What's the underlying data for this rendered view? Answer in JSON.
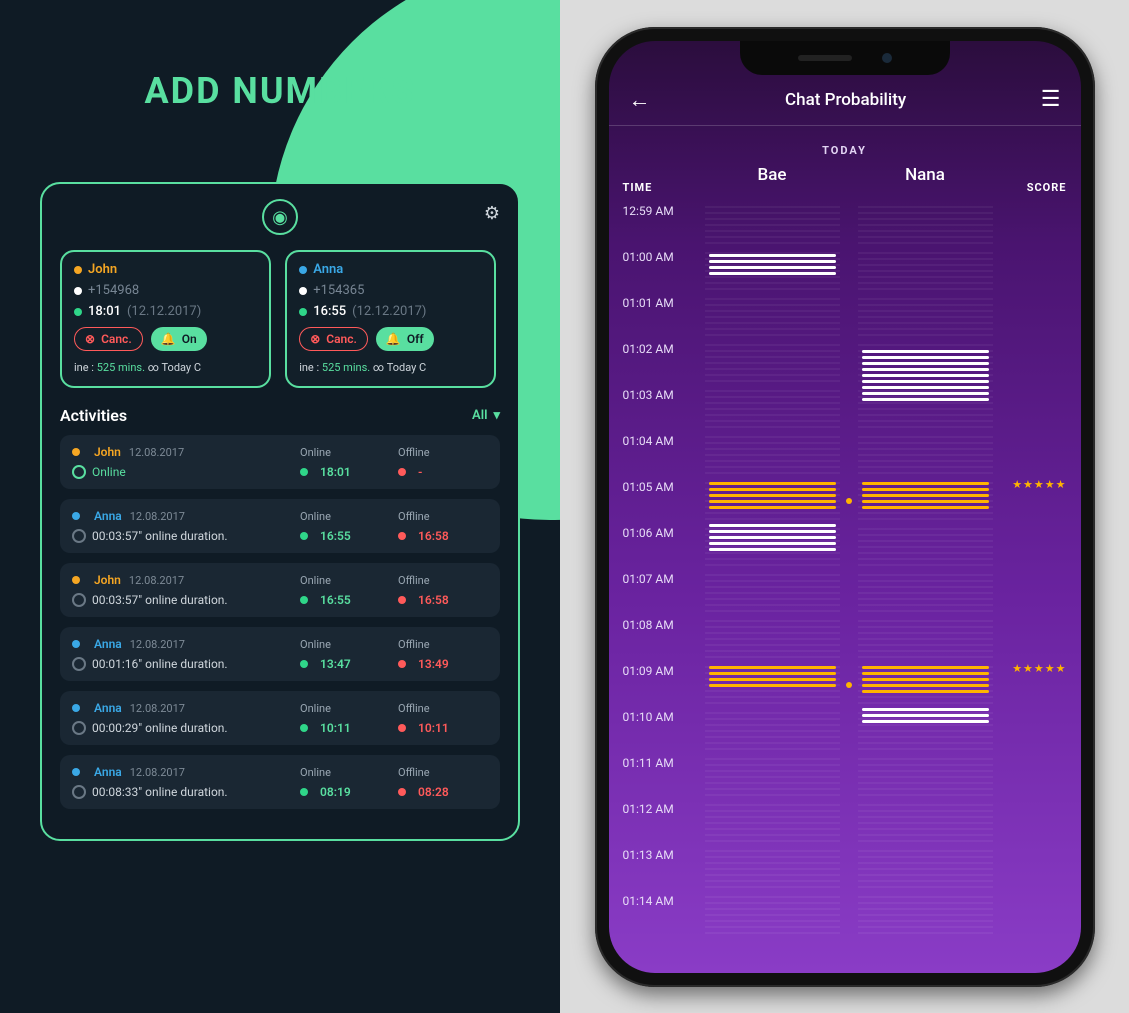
{
  "left": {
    "title": "ADD NUMBERS",
    "contacts": [
      {
        "name": "John",
        "nameClass": "name-orange",
        "dotClass": "dot-orange",
        "phone": "+154968",
        "time": "18:01",
        "date": "(12.12.2017)",
        "toggle": "On",
        "cancel": "Canc.",
        "ticker_prefix": "ine :",
        "ticker_mins": "525 mins.",
        "ticker_tail": "∞  Today  C"
      },
      {
        "name": "Anna",
        "nameClass": "name-blue",
        "dotClass": "dot-blue",
        "phone": "+154365",
        "time": "16:55",
        "date": "(12.12.2017)",
        "toggle": "Off",
        "cancel": "Canc.",
        "ticker_prefix": "ine :",
        "ticker_mins": "525 mins.",
        "ticker_tail": "∞  Today  C"
      }
    ],
    "activities_title": "Activities",
    "filter": "All",
    "headers": {
      "online": "Online",
      "offline": "Offline"
    },
    "activities": [
      {
        "name": "John",
        "nameClass": "name-orange",
        "dotClass": "dot-orange",
        "date": "12.08.2017",
        "status": "Online",
        "statusIcon": "green",
        "online": "18:01",
        "offline": "-"
      },
      {
        "name": "Anna",
        "nameClass": "name-blue",
        "dotClass": "dot-blue",
        "date": "12.08.2017",
        "status": "00:03:57\" online duration.",
        "statusIcon": "grey",
        "online": "16:55",
        "offline": "16:58"
      },
      {
        "name": "John",
        "nameClass": "name-orange",
        "dotClass": "dot-orange",
        "date": "12.08.2017",
        "status": "00:03:57\" online duration.",
        "statusIcon": "grey",
        "online": "16:55",
        "offline": "16:58"
      },
      {
        "name": "Anna",
        "nameClass": "name-blue",
        "dotClass": "dot-blue",
        "date": "12.08.2017",
        "status": "00:01:16\" online duration.",
        "statusIcon": "grey",
        "online": "13:47",
        "offline": "13:49"
      },
      {
        "name": "Anna",
        "nameClass": "name-blue",
        "dotClass": "dot-blue",
        "date": "12.08.2017",
        "status": "00:00:29\" online duration.",
        "statusIcon": "grey",
        "online": "10:11",
        "offline": "10:11"
      },
      {
        "name": "Anna",
        "nameClass": "name-blue",
        "dotClass": "dot-blue",
        "date": "12.08.2017",
        "status": "00:08:33\" online duration.",
        "statusIcon": "grey",
        "online": "08:19",
        "offline": "08:28"
      }
    ]
  },
  "right": {
    "title": "Chat Probability",
    "today": "TODAY",
    "cols": {
      "time": "TIME",
      "p1": "Bae",
      "p2": "Nana",
      "score": "SCORE"
    },
    "rows": [
      {
        "time": "12:59 AM",
        "p1": null,
        "p2": null,
        "score": ""
      },
      {
        "time": "01:00 AM",
        "p1": {
          "color": "white",
          "count": 4,
          "offset": 6
        },
        "p2": null,
        "score": ""
      },
      {
        "time": "01:01 AM",
        "p1": null,
        "p2": null,
        "score": ""
      },
      {
        "time": "01:02 AM",
        "p1": null,
        "p2": {
          "color": "white",
          "count": 6,
          "offset": 10
        },
        "score": ""
      },
      {
        "time": "01:03 AM",
        "p1": null,
        "p2": {
          "color": "white",
          "count": 3,
          "offset": 0
        },
        "score": ""
      },
      {
        "time": "01:04 AM",
        "p1": null,
        "p2": null,
        "score": ""
      },
      {
        "time": "01:05 AM",
        "p1": {
          "color": "gold",
          "count": 5,
          "offset": 4
        },
        "p2": {
          "color": "gold",
          "count": 5,
          "offset": 4
        },
        "score": "★★★★★",
        "dot": true
      },
      {
        "time": "01:06 AM",
        "p1": {
          "color": "white",
          "count": 5,
          "offset": 0
        },
        "p2": null,
        "score": ""
      },
      {
        "time": "01:07 AM",
        "p1": null,
        "p2": null,
        "score": ""
      },
      {
        "time": "01:08 AM",
        "p1": null,
        "p2": null,
        "score": ""
      },
      {
        "time": "01:09 AM",
        "p1": {
          "color": "gold",
          "count": 4,
          "offset": 4
        },
        "p2": {
          "color": "gold",
          "count": 5,
          "offset": 4
        },
        "score": "★★★★★",
        "dot": true
      },
      {
        "time": "01:10 AM",
        "p1": null,
        "p2": {
          "color": "white",
          "count": 3,
          "offset": 0
        },
        "score": ""
      },
      {
        "time": "01:11 AM",
        "p1": null,
        "p2": null,
        "score": ""
      },
      {
        "time": "01:12 AM",
        "p1": null,
        "p2": null,
        "score": ""
      },
      {
        "time": "01:13 AM",
        "p1": null,
        "p2": null,
        "score": ""
      },
      {
        "time": "01:14 AM",
        "p1": null,
        "p2": null,
        "score": ""
      }
    ]
  }
}
